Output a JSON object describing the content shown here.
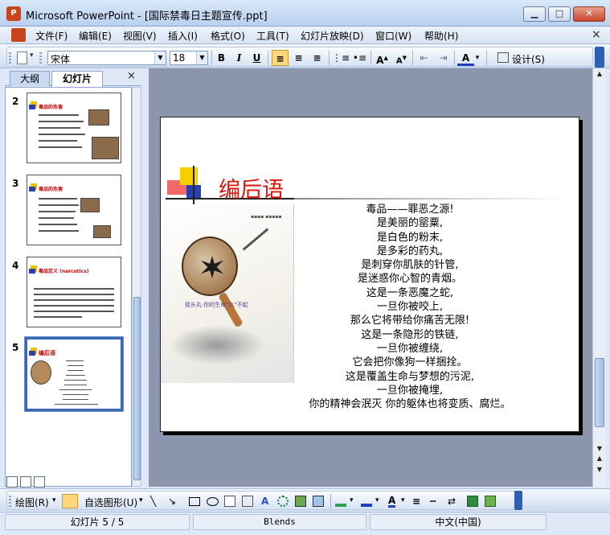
{
  "window": {
    "title": "Microsoft PowerPoint - [国际禁毒日主题宣传.ppt]",
    "minimize": "▁",
    "maximize": "□",
    "close": "✕"
  },
  "menu": {
    "items": [
      "文件(F)",
      "编辑(E)",
      "视图(V)",
      "插入(I)",
      "格式(O)",
      "工具(T)",
      "幻灯片放映(D)",
      "窗口(W)",
      "帮助(H)"
    ],
    "close": "×"
  },
  "format_toolbar": {
    "font_name": "宋体",
    "font_size": "18",
    "bold": "B",
    "italic": "I",
    "underline": "U",
    "design_label": "设计(S)"
  },
  "left_pane": {
    "tabs": [
      "大纲",
      "幻灯片"
    ],
    "close": "×",
    "slides": [
      {
        "num": "2",
        "title": "毒品的危害"
      },
      {
        "num": "3",
        "title": "毒品的危害"
      },
      {
        "num": "4",
        "title": "毒品定义 (narcotics)"
      },
      {
        "num": "5",
        "title": "编后语"
      }
    ]
  },
  "slide": {
    "title": "编后语",
    "photo_caption": "摇头丸·你的生命\"丸\"不起",
    "poem": [
      "毒品——罪恶之源!",
      "是美丽的罂粟,",
      "是白色的粉末,",
      "是多彩的药丸,",
      "是刺穿你肌肤的针管,",
      "是迷惑你心智的青烟。",
      "这是一条恶魔之蛇,",
      "一旦你被咬上,",
      "那么它将带给你痛苦无限!",
      "这是一条隐形的铁链,",
      "一旦你被缠绕,",
      "它会把你像狗一样捆拴。",
      "这是覆盖生命与梦想的污泥,",
      "一旦你被掩埋,",
      "你的精神会泯灭 你的躯体也将变质、腐烂。"
    ]
  },
  "draw_toolbar": {
    "draw_label": "绘图(R)",
    "autoshape_label": "自选图形(U)"
  },
  "status": {
    "slide": "幻灯片 5 / 5",
    "design": "Blends",
    "language": "中文(中国)"
  },
  "colors": {
    "title_red": "#e0140b",
    "accent_blue": "#3a67b3"
  }
}
